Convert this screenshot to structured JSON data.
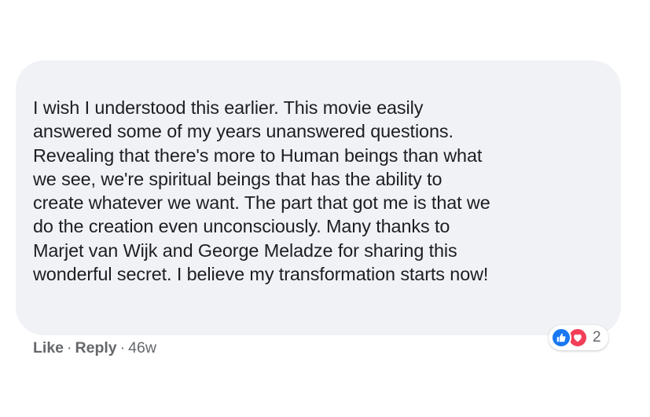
{
  "comment": {
    "lines": [
      "I wish I understood this earlier. This movie easily",
      "answered some of my years unanswered questions.",
      "Revealing that there's more to Human beings than what",
      "we see, we're spiritual beings that has the ability to",
      "create whatever we want. The part that got me is that we",
      "do the creation even unconsciously. Many thanks to",
      "Marjet van Wijk and George Meladze for sharing this",
      "wonderful secret. I believe my transformation starts now!"
    ]
  },
  "reactions": {
    "icons": [
      "like-icon",
      "love-icon"
    ],
    "count": "2",
    "colors": {
      "like": "#1877f2",
      "love": "#f33e58"
    }
  },
  "actions": {
    "like_label": "Like",
    "separator": "·",
    "reply_label": "Reply",
    "timestamp": "46w"
  },
  "colors": {
    "bubble_background": "#f0f2f5",
    "meta_text": "#65676b"
  }
}
